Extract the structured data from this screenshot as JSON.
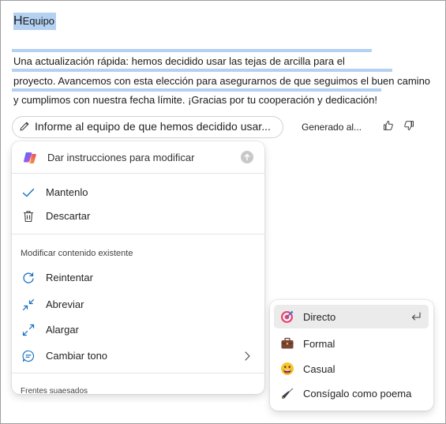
{
  "document": {
    "title_initial": "H",
    "title_rest": "Equipo ",
    "paragraph_line1": "Una actualización rápida: hemos decidido usar las tejas de arcilla para el",
    "paragraph_line2": "proyecto. Avancemos con esta elección para asegurarnos de que seguimos el buen camino",
    "paragraph_line3": "y cumplimos con nuestra fecha límite. ¡Gracias por tu cooperación y dedicación!"
  },
  "prompt": {
    "text": "Informe al equipo de que hemos decidido usar...",
    "generated_label": "Generado al..."
  },
  "menu": {
    "instruction_placeholder": "Dar instrucciones para modificar",
    "keep_label": "Mantenlo",
    "discard_label": "Descartar",
    "modify_section_label": "Modificar contenido existente",
    "retry_label": "Reintentar",
    "shorten_label": "Abreviar",
    "lengthen_label": "Alargar",
    "tone_label": "Cambiar tono",
    "frequent_section_label": "Frentes suaesados"
  },
  "tone_submenu": {
    "items": [
      {
        "label": "Directo",
        "icon": "target-icon",
        "selected": true
      },
      {
        "label": "Formal",
        "icon": "briefcase-icon",
        "selected": false
      },
      {
        "label": "Casual",
        "icon": "grinning-face-icon",
        "selected": false
      },
      {
        "label": "Consígalo como poema",
        "icon": "fountain-pen-icon",
        "selected": false
      }
    ]
  },
  "colors": {
    "selection_highlight": "#b4d1f2",
    "menu_hover": "#ebebeb",
    "accent_blue": "#0f6cbd"
  }
}
